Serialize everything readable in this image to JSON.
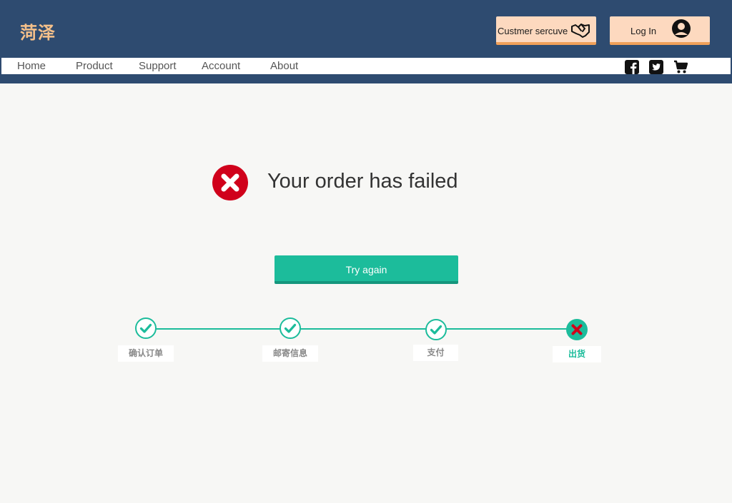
{
  "header": {
    "brand": "菏泽",
    "service_button": {
      "label": "Custmer sercuve",
      "icon": "handshake-icon"
    },
    "login_button": {
      "label": "Log In",
      "icon": "user-circle-icon"
    }
  },
  "nav": {
    "items": [
      "Home",
      "Product",
      "Support",
      "Account",
      "About"
    ],
    "icons": [
      "facebook-icon",
      "twitter-icon",
      "cart-icon"
    ]
  },
  "result": {
    "message": "Your order has failed",
    "icon": "error-circle-icon",
    "retry_label": "Try again"
  },
  "progress": {
    "steps": [
      {
        "label": "确认订单",
        "status": "done"
      },
      {
        "label": "邮寄信息",
        "status": "done"
      },
      {
        "label": "支付",
        "status": "done"
      },
      {
        "label": "出货",
        "status": "failed"
      }
    ]
  },
  "colors": {
    "header_bg": "#2e4b70",
    "brand": "#f5c08a",
    "accent": "#1cbc9b",
    "error": "#d0011b",
    "top_button_bg": "#fdd9bf"
  }
}
